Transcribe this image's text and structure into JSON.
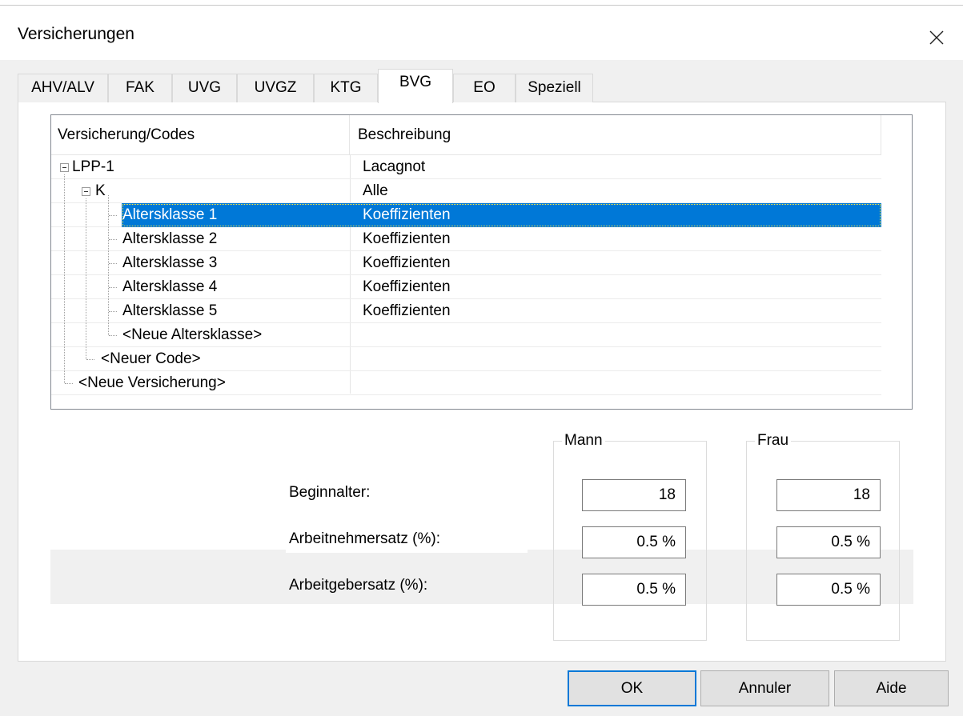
{
  "window": {
    "title": "Versicherungen",
    "close_glyph": "×"
  },
  "tabs": [
    {
      "label": "AHV/ALV"
    },
    {
      "label": "FAK"
    },
    {
      "label": "UVG"
    },
    {
      "label": "UVGZ"
    },
    {
      "label": "KTG"
    },
    {
      "label": "BVG",
      "active": true
    },
    {
      "label": "EO"
    },
    {
      "label": "Speziell"
    }
  ],
  "tree": {
    "columns": [
      "Versicherung/Codes",
      "Beschreibung"
    ],
    "rows": [
      {
        "name": "LPP-1",
        "desc": "Lacagnot",
        "level": 0,
        "expanded": true
      },
      {
        "name": "K",
        "desc": "Alle",
        "level": 1,
        "expanded": true
      },
      {
        "name": "Altersklasse 1",
        "desc": "Koeffizienten",
        "level": 2,
        "selected": true
      },
      {
        "name": "Altersklasse 2",
        "desc": "Koeffizienten",
        "level": 2
      },
      {
        "name": "Altersklasse 3",
        "desc": "Koeffizienten",
        "level": 2
      },
      {
        "name": "Altersklasse 4",
        "desc": "Koeffizienten",
        "level": 2
      },
      {
        "name": "Altersklasse 5",
        "desc": "Koeffizienten",
        "level": 2
      },
      {
        "name": "<Neue Altersklasse>",
        "desc": "",
        "level": 2
      },
      {
        "name": "<Neuer Code>",
        "desc": "",
        "level": 1
      },
      {
        "name": "<Neue Versicherung>",
        "desc": "",
        "level": 0
      }
    ]
  },
  "rates": {
    "group_mann": "Mann",
    "group_frau": "Frau",
    "beginnalter_label": "Beginnalter:",
    "arbeitnehmer_label": "Arbeitnehmersatz (%):",
    "arbeitgeber_label": "Arbeitgebersatz (%):",
    "mann": {
      "beginnalter": "18",
      "arbeitnehmer": "0.5 %",
      "arbeitgeber": "0.5 %"
    },
    "frau": {
      "beginnalter": "18",
      "arbeitnehmer": "0.5 %",
      "arbeitgeber": "0.5 %"
    }
  },
  "buttons": {
    "ok": "OK",
    "cancel": "Annuler",
    "help": "Aide"
  },
  "colors": {
    "selection": "#0078d7",
    "default_button_border": "#0078d7"
  }
}
